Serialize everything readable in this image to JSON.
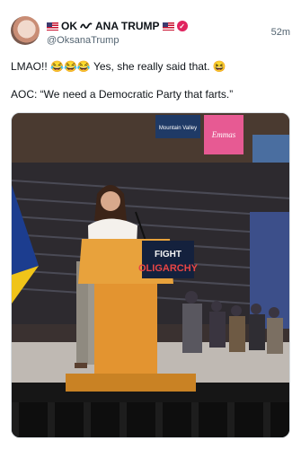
{
  "post": {
    "author": {
      "display_name_prefix": "OK",
      "display_name_mid": "ANA TRUMP",
      "handle": "@OksanaTrump",
      "verified_icon": "check-badge-icon",
      "flag_icon": "us-flag-icon"
    },
    "timestamp": "52m",
    "text_line_1": "LMAO!! 😂😂😂 Yes, she really said that. 😆",
    "text_line_2": "AOC: “We need a Democratic Party that farts.”",
    "media": {
      "podium_sign_line_1": "FIGHT",
      "podium_sign_line_2": "OLIGARCHY",
      "banner_text": "Mountain Valley",
      "pink_banner_text": "Emmas"
    }
  },
  "colors": {
    "accent": "#e0245e",
    "secondary_text": "#536471",
    "podium": "#e8a23c"
  }
}
